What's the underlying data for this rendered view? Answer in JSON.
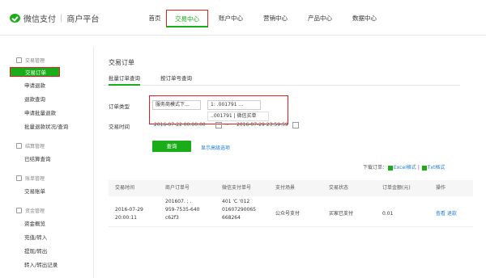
{
  "brand": {
    "name": "微信支付",
    "sep": "|",
    "platform": "商户平台"
  },
  "nav": [
    "首页",
    "交易中心",
    "账户中心",
    "营销中心",
    "产品中心",
    "数据中心"
  ],
  "sidebar": {
    "groups": [
      {
        "title": "交易管理",
        "items": [
          "交易订单",
          "申请退款",
          "退款查询",
          "申请批量退款",
          "批量退款状况/查询"
        ]
      },
      {
        "title": "结算管理",
        "items": [
          "已结算查询"
        ]
      },
      {
        "title": "账单管理",
        "items": [
          "交易账单"
        ]
      },
      {
        "title": "资金管理",
        "items": [
          "资金概览",
          "充值/转入",
          "提现/转出",
          "转入/转出记录"
        ]
      }
    ]
  },
  "page": {
    "title": "交易订单",
    "tabs": [
      "批量订单查询",
      "按订单号查询"
    ],
    "order_type_label": "订单类型",
    "order_type_value": "服务商模式下...",
    "merchant_value": "1:  .001791 ...",
    "dropdown_option": "..001791 | 微信买单",
    "time_label": "交易时间",
    "time_start": "2016-07-22 00:00:00",
    "time_sep": "~",
    "time_end": "2016-07-29 23:59:59",
    "query_button": "查询",
    "advanced_link": "显示高级选项",
    "download_label": "下载订单：",
    "download_excel": "Excel格式",
    "download_txt": "Txt格式"
  },
  "table": {
    "headers": [
      "交易时间",
      "商户订单号",
      "微信支付单号",
      "支付场景",
      "交易状态",
      "订单金额(元)",
      "操作"
    ],
    "rows": [
      {
        "time": "2016-07-29\n20:00:11",
        "merchant_no": "201607. ;  .\n959-7535-640\nc62f3",
        "wx_no": "401  'C  '012\n01607290065\n668264",
        "scene": "公众号支付",
        "status": "买家已支付",
        "amount": "0.01",
        "ops": "查看  退款"
      }
    ]
  },
  "colors": {
    "brand": "#1aad19",
    "highlight": "#e02020",
    "link": "#1d7ad9"
  }
}
